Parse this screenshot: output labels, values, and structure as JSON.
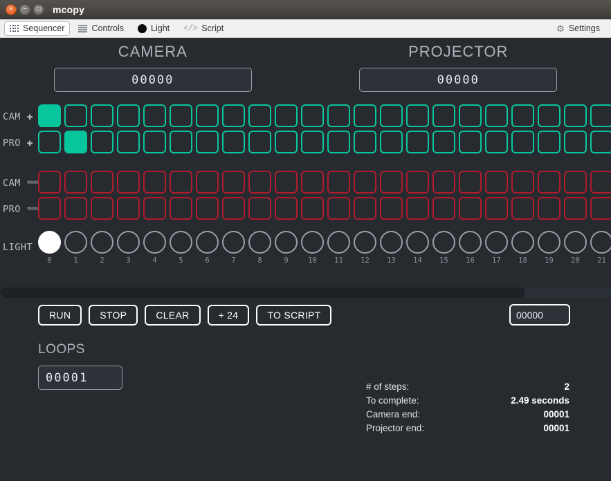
{
  "window": {
    "title": "mcopy",
    "buttons": {
      "close": "×",
      "minimize": "−",
      "maximize": "□"
    }
  },
  "tabs": [
    {
      "label": "Sequencer",
      "icon": "grid-icon",
      "active": true
    },
    {
      "label": "Controls",
      "icon": "sliders-icon",
      "active": false
    },
    {
      "label": "Light",
      "icon": "circle-icon",
      "active": false
    },
    {
      "label": "Script",
      "icon": "code-icon",
      "active": false
    }
  ],
  "settings": {
    "label": "Settings",
    "icon": "gear-icon"
  },
  "columns": {
    "camera": {
      "title": "CAMERA",
      "counter": "00000"
    },
    "projector": {
      "title": "PROJECTOR",
      "counter": "00000"
    }
  },
  "sequencer": {
    "visible_steps": 22,
    "step_numbers": [
      "0",
      "1",
      "2",
      "3",
      "4",
      "5",
      "6",
      "7",
      "8",
      "9",
      "10",
      "11",
      "12",
      "13",
      "14",
      "15",
      "16",
      "17",
      "18",
      "19",
      "20",
      "21"
    ],
    "rows": [
      {
        "name": "cam-plus",
        "label": "CAM",
        "sign": "✚",
        "type": "plus",
        "on_steps": [
          0
        ]
      },
      {
        "name": "pro-plus",
        "label": "PRO",
        "sign": "✚",
        "type": "plus",
        "on_steps": [
          1
        ]
      },
      {
        "name": "cam-minus",
        "label": "CAM",
        "sign": "➖",
        "type": "minus",
        "on_steps": []
      },
      {
        "name": "pro-minus",
        "label": "PRO",
        "sign": "➖",
        "type": "minus",
        "on_steps": []
      }
    ],
    "light_row": {
      "label": "LIGHT",
      "on_steps": [
        0
      ]
    }
  },
  "scrollbar": {
    "thumb_percent": 86
  },
  "toolbar": {
    "buttons": [
      "RUN",
      "STOP",
      "CLEAR",
      "+ 24",
      "TO SCRIPT"
    ],
    "step_value": "00000",
    "step_placeholder": "00000"
  },
  "loops": {
    "title": "LOOPS",
    "value": "00001",
    "placeholder": "00001"
  },
  "stats": [
    {
      "label": "# of steps:",
      "value": "2"
    },
    {
      "label": "To complete:",
      "value": "2.49 seconds"
    },
    {
      "label": "Camera end:",
      "value": "00001"
    },
    {
      "label": "Projector end:",
      "value": "00001"
    }
  ],
  "colors": {
    "background": "#272b30",
    "plus": "#07c69e",
    "minus": "#b01b2e",
    "light_on": "#ffffff",
    "tabbar": "#f0f0f0",
    "titlebar": "#4b4844",
    "close_button": "#e8550d"
  }
}
